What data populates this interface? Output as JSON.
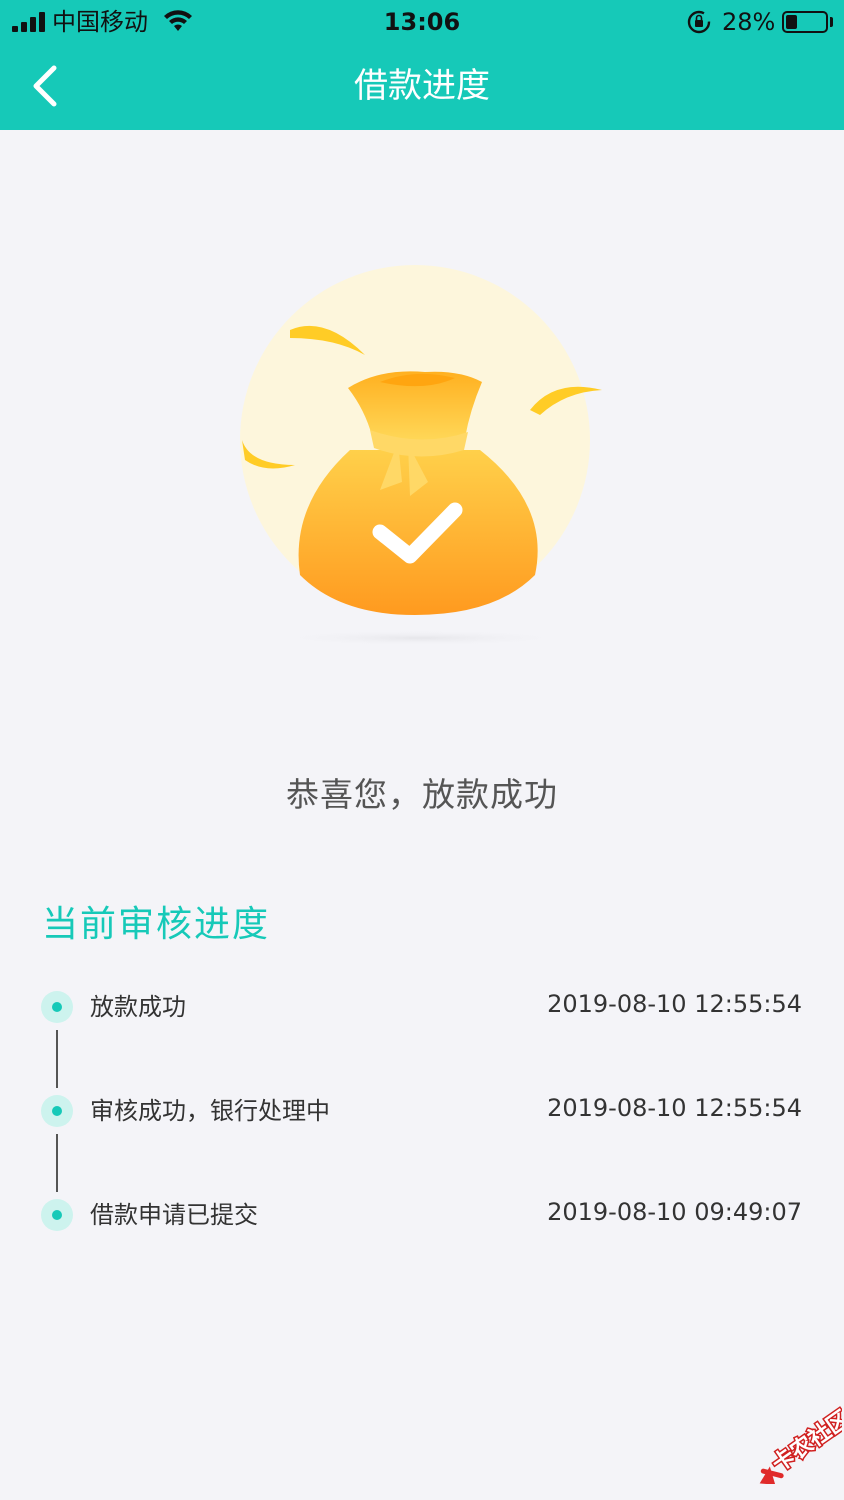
{
  "status_bar": {
    "carrier": "中国移动",
    "time": "13:06",
    "battery_percent_label": "28%",
    "battery_level": 0.28
  },
  "nav": {
    "title": "借款进度",
    "back_icon": "chevron-left-icon"
  },
  "illustration": {
    "icon": "money-bag-check-icon",
    "colors": {
      "circle": "#fdf6dc",
      "bag": "#ffae2b",
      "check": "#ffffff"
    }
  },
  "result": {
    "message": "恭喜您，放款成功"
  },
  "progress": {
    "title": "当前审核进度",
    "steps": [
      {
        "label": "放款成功",
        "time": "2019-08-10 12:55:54"
      },
      {
        "label": "审核成功，银行处理中",
        "time": "2019-08-10 12:55:54"
      },
      {
        "label": "借款申请已提交",
        "time": "2019-08-10 09:49:07"
      }
    ]
  },
  "watermark": {
    "text": "卡农社区"
  },
  "colors": {
    "accent": "#16c9b8",
    "background": "#f4f4f8"
  }
}
